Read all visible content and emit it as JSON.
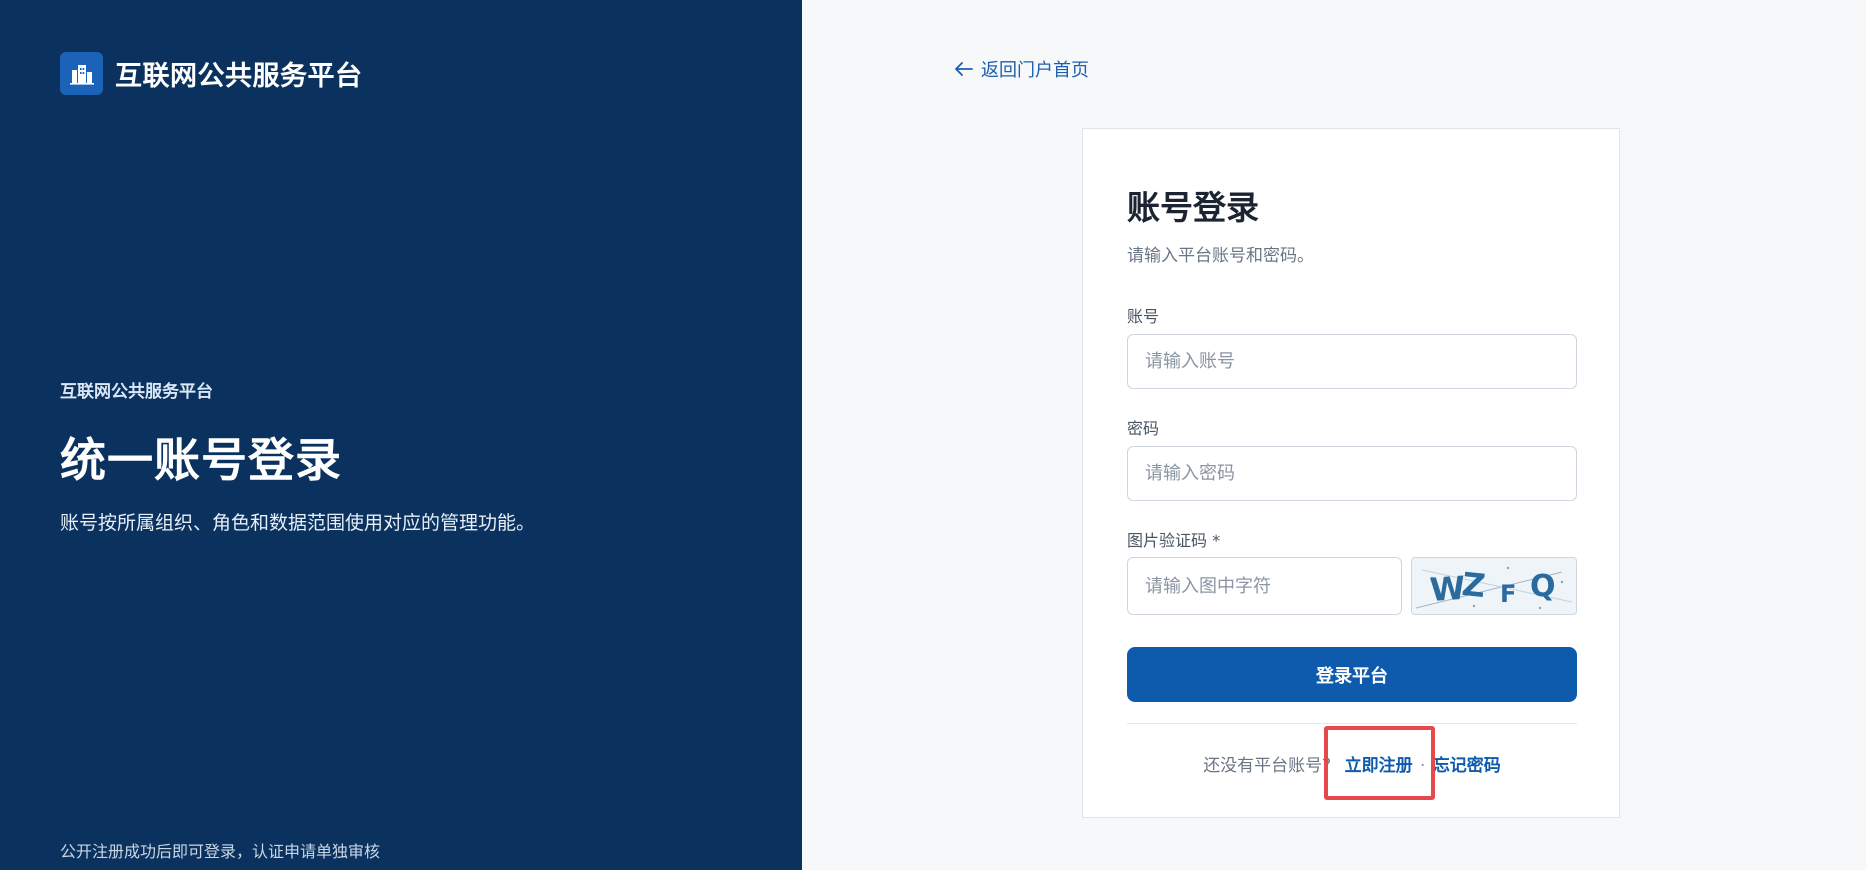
{
  "brand": {
    "name": "互联网公共服务平台",
    "logo_icon": "building-icon"
  },
  "hero": {
    "eyebrow": "互联网公共服务平台",
    "title": "统一账号登录",
    "description": "账号按所属组织、角色和数据范围使用对应的管理功能。"
  },
  "left_footer": "公开注册成功后即可登录，认证申请单独审核",
  "nav": {
    "back_label": "返回门户首页",
    "back_icon": "arrow-left-icon"
  },
  "login_card": {
    "title": "账号登录",
    "subtitle": "请输入平台账号和密码。",
    "account": {
      "label": "账号",
      "placeholder": "请输入账号",
      "value": ""
    },
    "password": {
      "label": "密码",
      "placeholder": "请输入密码",
      "value": ""
    },
    "captcha": {
      "label": "图片验证码 *",
      "placeholder": "请输入图中字符",
      "value": "",
      "image_text": "WZFQ"
    },
    "submit_label": "登录平台",
    "footer": {
      "prompt": "还没有平台账号？",
      "register_label": "立即注册",
      "separator": "·",
      "forgot_label": "忘记密码"
    }
  },
  "colors": {
    "left_panel_bg": "#0b325e",
    "primary": "#0e5bad",
    "highlight": "#e5484d"
  }
}
